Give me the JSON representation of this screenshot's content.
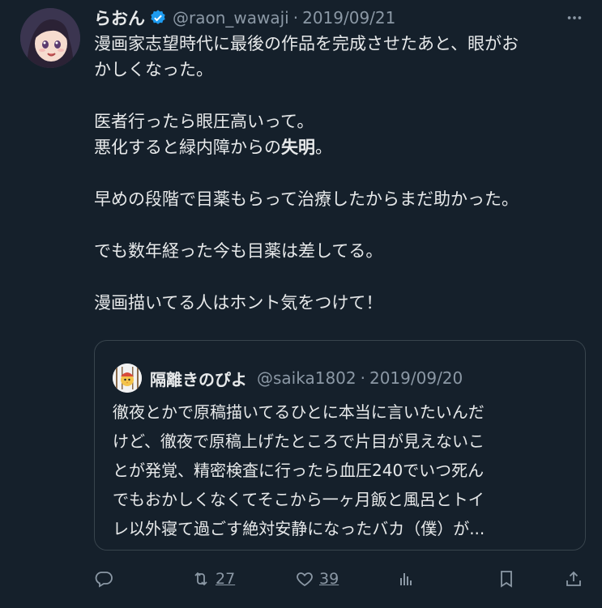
{
  "tweet": {
    "author_name": "らおん",
    "author_handle": "@raon_wawaji",
    "separator": "·",
    "date": "2019/09/21",
    "body": [
      "漫画家志望時代に最後の作品を完成させたあと、眼がお",
      "かしくなった。",
      "",
      "医者行ったら眼圧高いって。",
      {
        "plain": "悪化すると緑内障からの",
        "bold": "失明",
        "after": "。"
      },
      "",
      "早めの段階で目薬もらって治療したからまだ助かった。",
      "",
      "でも数年経った今も目薬は差してる。",
      "",
      "漫画描いてる人はホント気をつけて！"
    ]
  },
  "quoted": {
    "author_name": "隔離きのぴよ",
    "author_handle": "@saika1802",
    "separator": "·",
    "date": "2019/09/20",
    "lines": [
      "徹夜とかで原稿描いてるひとに本当に言いたいんだ",
      "けど、徹夜で原稿上げたところで片目が見えないこ",
      "とが発覚、精密検査に行ったら血圧240でいつ死ん",
      "でもおかしくなくてそこから一ヶ月飯と風呂とトイ",
      "レ以外寝て過ごす絶対安静になったバカ（僕）が..."
    ]
  },
  "actions": {
    "reply": {
      "icon": "reply-icon",
      "count": ""
    },
    "retweet": {
      "icon": "retweet-icon",
      "count": "27"
    },
    "like": {
      "icon": "heart-icon",
      "count": "39"
    },
    "views": {
      "icon": "analytics-icon"
    },
    "bookmark": {
      "icon": "bookmark-icon"
    },
    "share": {
      "icon": "share-icon"
    }
  },
  "colors": {
    "background": "#15202b",
    "text": "#e7e9ea",
    "muted": "#8b98a5",
    "verified": "#1d9bf0",
    "border": "#38444d"
  }
}
